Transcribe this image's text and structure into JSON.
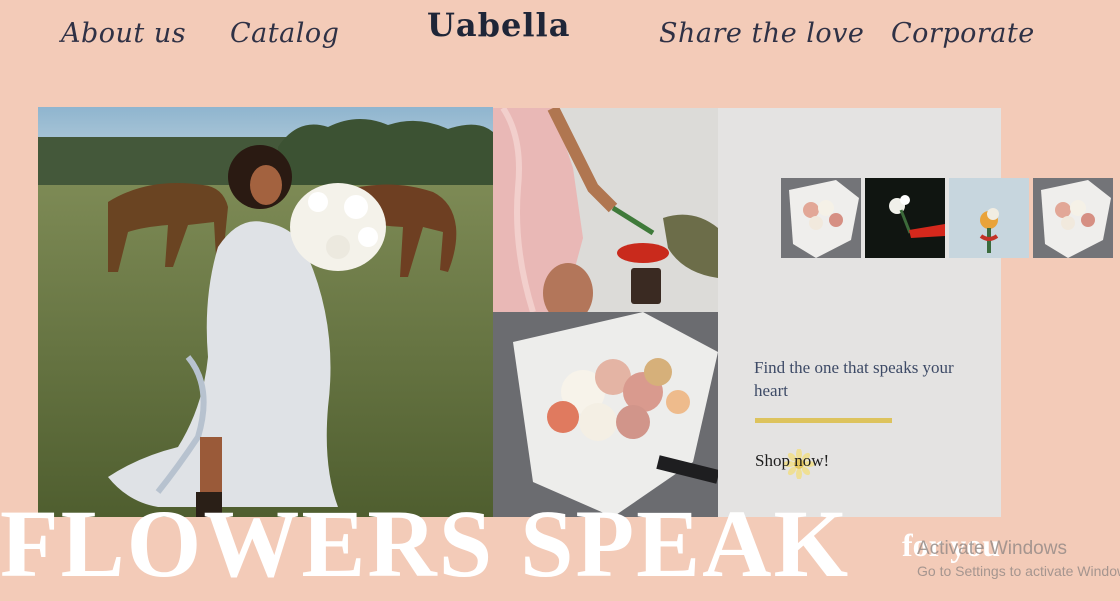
{
  "nav": {
    "about": "About us",
    "catalog": "Catalog",
    "brand": "Uabella",
    "share": "Share the love",
    "corporate": "Corporate"
  },
  "promo": {
    "tagline": "Find the one that speaks your heart",
    "shop_label": "Shop now!"
  },
  "headline": {
    "main": "FLOWERS SPEAK",
    "sub": "for you"
  },
  "windows_watermark": {
    "title": "Activate Windows",
    "subtitle": "Go to Settings to activate Windows."
  },
  "colors": {
    "background": "#f3cbb8",
    "panel": "#e4e3e2",
    "accent": "#ddc35d",
    "text_dark": "#2f3145"
  },
  "thumbnails": [
    {
      "icon": "bouquet-wrapped-image"
    },
    {
      "icon": "white-flowers-dark-image"
    },
    {
      "icon": "orange-flower-blue-image"
    },
    {
      "icon": "bouquet-wrapped-image"
    }
  ]
}
